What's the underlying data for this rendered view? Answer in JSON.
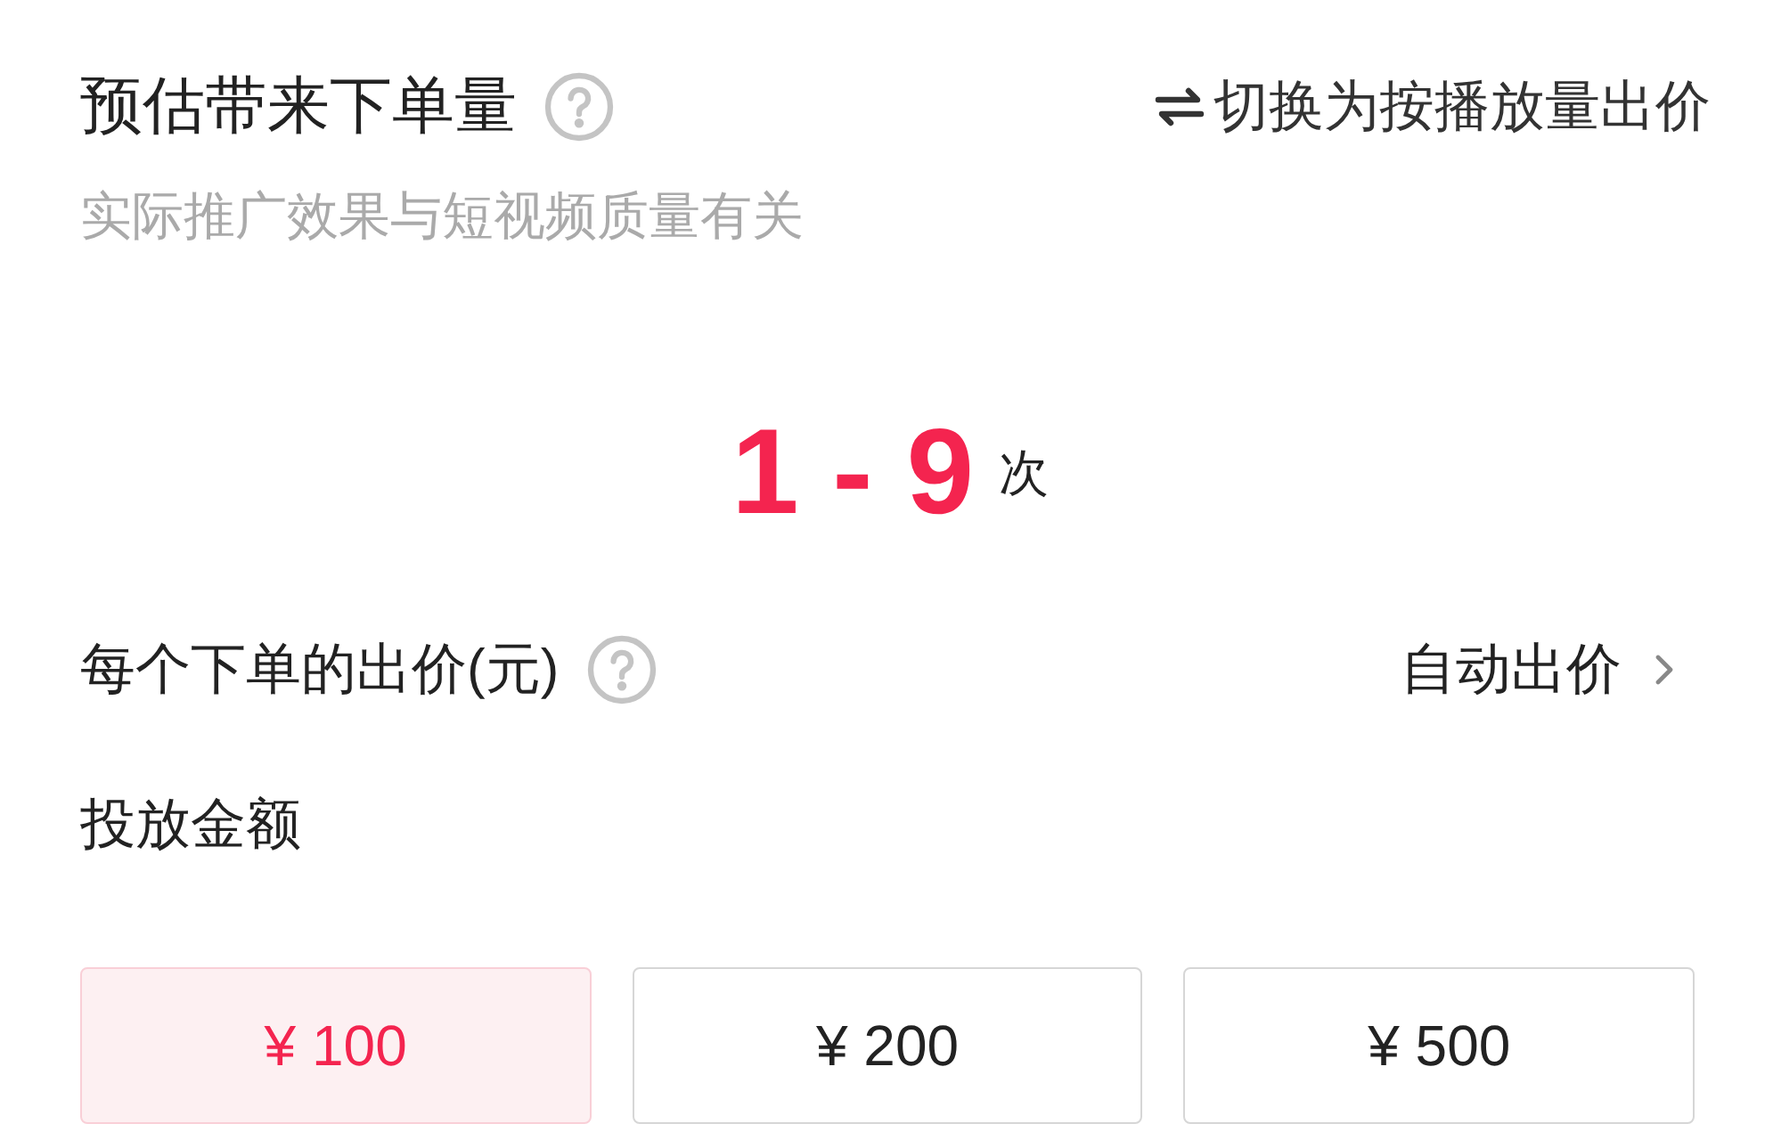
{
  "header": {
    "title": "预估带来下单量",
    "switch_link": "切换为按播放量出价",
    "subtitle": "实际推广效果与短视频质量有关"
  },
  "estimate": {
    "low": "1",
    "separator": "-",
    "high": "9",
    "unit": "次"
  },
  "bid": {
    "label": "每个下单的出价(元)",
    "value": "自动出价"
  },
  "budget": {
    "label": "投放金额",
    "options": [
      {
        "label": "¥ 100",
        "selected": true
      },
      {
        "label": "¥ 200",
        "selected": false
      },
      {
        "label": "¥ 500",
        "selected": false
      }
    ]
  }
}
